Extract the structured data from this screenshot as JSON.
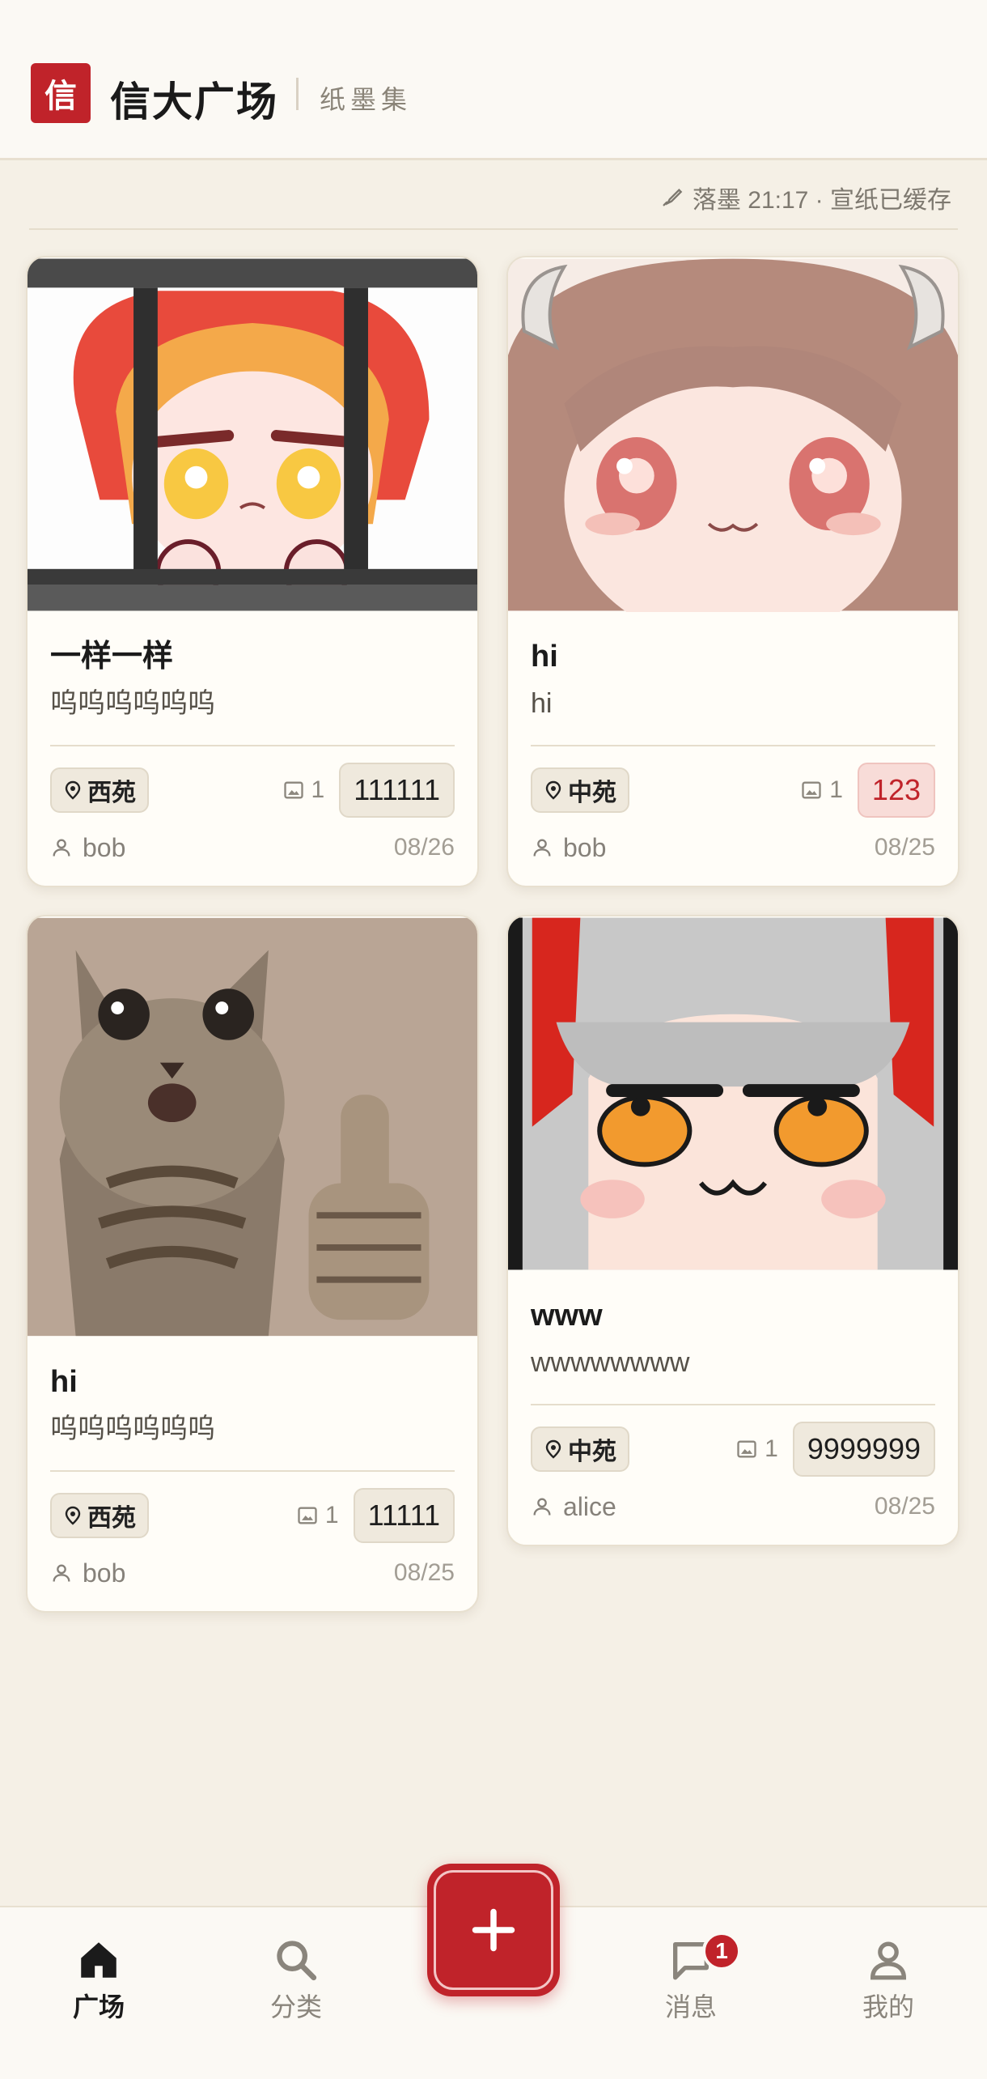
{
  "header": {
    "logo_char": "信",
    "app_name": "信大广场",
    "sub_name": "纸墨集"
  },
  "status": {
    "text": "落墨 21:17 · 宣纸已缓存"
  },
  "posts": [
    {
      "title": "一样一样",
      "desc": "呜呜呜呜呜呜",
      "location": "西苑",
      "image_count": "1",
      "price": "111111",
      "price_style": "normal",
      "user": "bob",
      "date": "08/26",
      "image": "anime-girl-red-hood-behind-bars"
    },
    {
      "title": "hi",
      "desc": "hi",
      "location": "中苑",
      "image_count": "1",
      "price": "123",
      "price_style": "red",
      "user": "bob",
      "date": "08/25",
      "image": "anime-girl-brown-hair-horns"
    },
    {
      "title": "hi",
      "desc": "呜呜呜呜呜呜",
      "location": "西苑",
      "image_count": "1",
      "price": "11111",
      "price_style": "normal",
      "user": "bob",
      "date": "08/25",
      "image": "cat-thumbs-up"
    },
    {
      "title": "www",
      "desc": "wwwwwwww",
      "location": "中苑",
      "image_count": "1",
      "price": "9999999",
      "price_style": "normal",
      "user": "alice",
      "date": "08/25",
      "image": "anime-girl-silver-hair-orange-eyes"
    }
  ],
  "nav": {
    "items": [
      {
        "label": "广场",
        "icon": "home-icon",
        "active": true
      },
      {
        "label": "分类",
        "icon": "search-icon",
        "active": false
      },
      {
        "label": "消息",
        "icon": "chat-icon",
        "active": false,
        "badge": "1"
      },
      {
        "label": "我的",
        "icon": "user-icon",
        "active": false
      }
    ],
    "fab_icon": "plus-icon"
  },
  "colors": {
    "accent": "#c0232a",
    "background": "#f5f0e6",
    "card": "#fffdf8"
  }
}
